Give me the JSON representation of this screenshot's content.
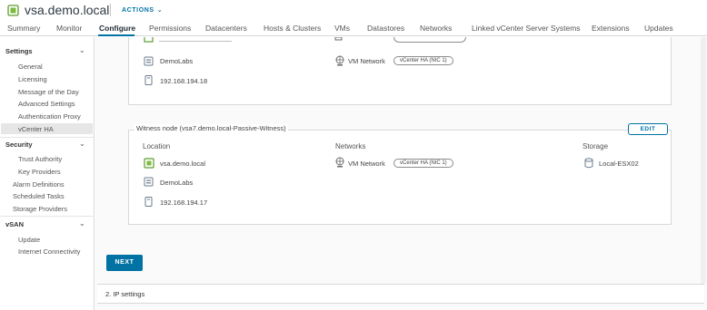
{
  "header": {
    "title": "vsa.demo.local",
    "actions_label": "ACTIONS",
    "accent": "#0072a3"
  },
  "tabs": [
    {
      "label": "Summary"
    },
    {
      "label": "Monitor"
    },
    {
      "label": "Configure",
      "active": true
    },
    {
      "label": "Permissions"
    },
    {
      "label": "Datacenters"
    },
    {
      "label": "Hosts & Clusters"
    },
    {
      "label": "VMs"
    },
    {
      "label": "Datastores"
    },
    {
      "label": "Networks"
    },
    {
      "label": "Linked vCenter Server Systems"
    },
    {
      "label": "Extensions"
    },
    {
      "label": "Updates"
    }
  ],
  "sidebar": {
    "settings": {
      "label": "Settings",
      "items": [
        "General",
        "Licensing",
        "Message of the Day",
        "Advanced Settings",
        "Authentication Proxy",
        "vCenter HA"
      ]
    },
    "security": {
      "label": "Security",
      "items": [
        "Trust Authority",
        "Key Providers"
      ]
    },
    "roots": [
      "Alarm Definitions",
      "Scheduled Tasks",
      "Storage Providers"
    ],
    "vsan": {
      "label": "vSAN",
      "items": [
        "Update",
        "Internet Connectivity"
      ]
    },
    "active_item": "vCenter HA"
  },
  "passive_node": {
    "location_datacenter": "DemoLabs",
    "location_ip": "192.168.194.18"
  },
  "witness_node": {
    "title": "Witness node (vsa7.demo.local-Passive-Witness)",
    "edit_label": "EDIT",
    "headers": {
      "location": "Location",
      "networks": "Networks",
      "storage": "Storage"
    },
    "location_host": "vsa.demo.local",
    "location_datacenter": "DemoLabs",
    "location_ip": "192.168.194.17",
    "network_name": "VM Network",
    "network_pill": "vCenter HA (NIC 1)",
    "storage": "Local-ESX02"
  },
  "next_label": "NEXT",
  "step2_label": "2. IP settings"
}
